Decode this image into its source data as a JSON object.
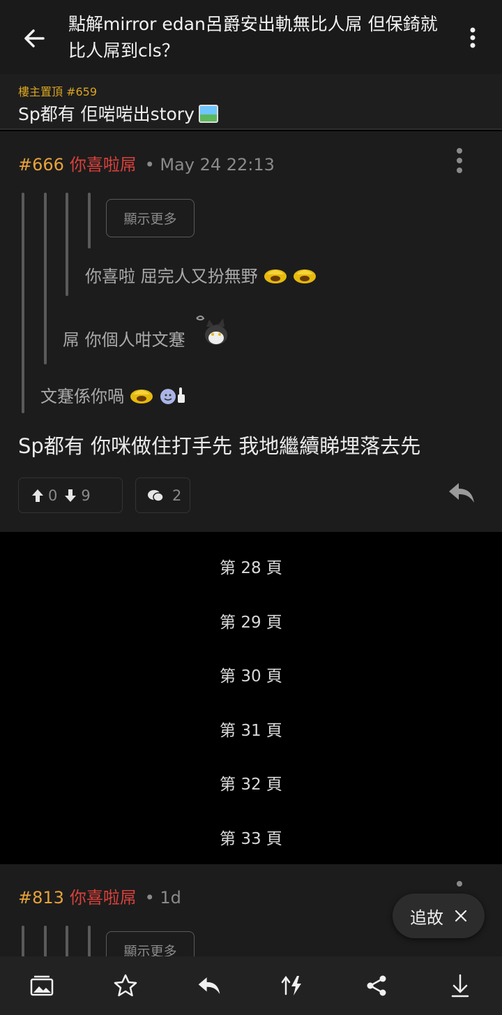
{
  "header": {
    "title": "點解mirror edan呂爵安出軌無比人屌 但保錡就比人屌到cls？"
  },
  "pinned": {
    "label": "樓主置頂 #659",
    "text": "Sp都有 佢啱啱出story"
  },
  "post1": {
    "num": "#666",
    "user": "你喜啦屌",
    "time": "• May 24 22:13",
    "show_more": "顯示更多",
    "quote3": "你喜啦 屈完人又扮無野",
    "quote2": "屌 你個人咁文蹇",
    "quote1": "文蹇係你喎",
    "body": "Sp都有 你咪做住打手先 我地繼續睇埋落去先",
    "upvotes": "0",
    "downvotes": "9",
    "comments": "2"
  },
  "pages": [
    "第 28 頁",
    "第 29 頁",
    "第 30 頁",
    "第 31 頁",
    "第 32 頁",
    "第 33 頁"
  ],
  "post2": {
    "num": "#813",
    "user": "你喜啦屌",
    "time": "• 1d",
    "show_more": "顯示更多"
  },
  "follow": {
    "label": "追故"
  },
  "colors": {
    "accent_orange": "#e8a23a",
    "username_red": "#d9413b",
    "pinned_gold": "#d9a521"
  }
}
